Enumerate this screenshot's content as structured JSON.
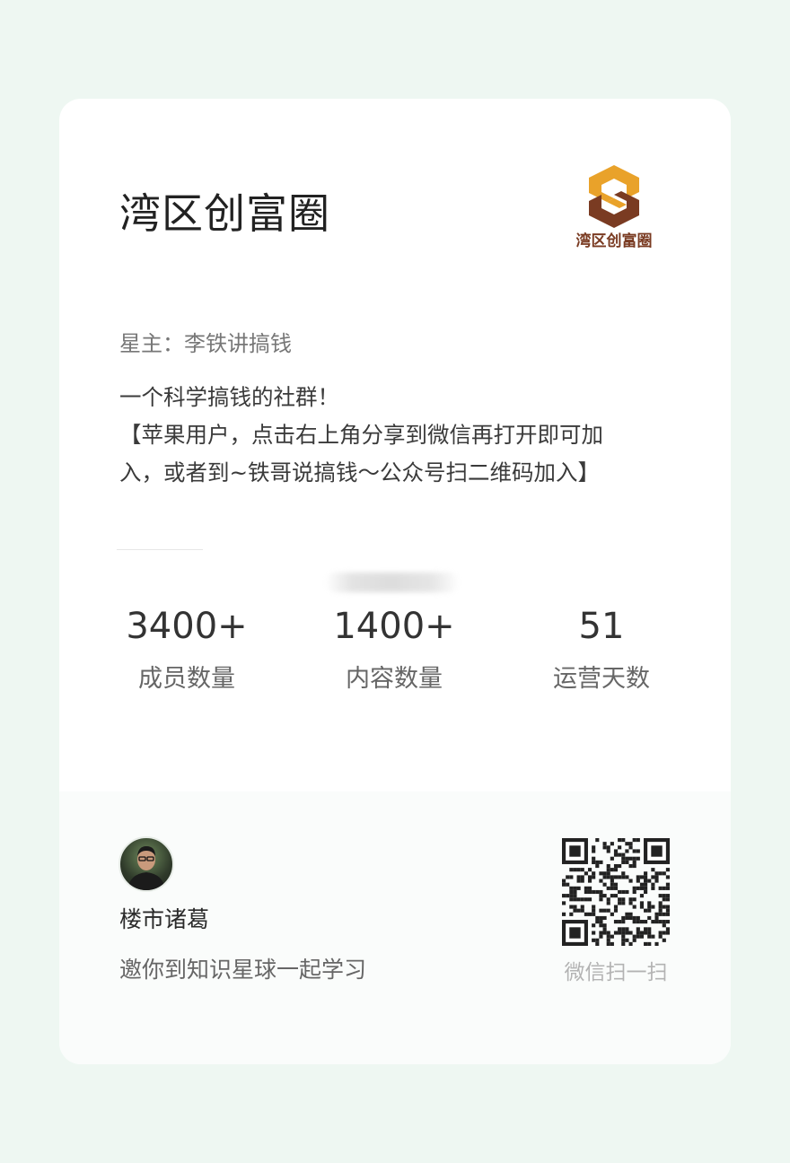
{
  "card": {
    "title": "湾区创富圈",
    "logo_text": "湾区创富圈",
    "owner": "星主：李铁讲搞钱",
    "description_lines": [
      "一个科学搞钱的社群！",
      "【苹果用户，点击右上角分享到微信再打开即可加",
      "入，或者到~铁哥说搞钱～公众号扫二维码加入】"
    ]
  },
  "stats": [
    {
      "value": "3400+",
      "label": "成员数量"
    },
    {
      "value": "1400+",
      "label": "内容数量"
    },
    {
      "value": "51",
      "label": "运营天数"
    }
  ],
  "footer": {
    "author_name": "楼市诸葛",
    "invite_text": "邀你到知识星球一起学习",
    "qr_caption": "微信扫一扫"
  },
  "icons": {
    "logo": "hexagon-s-logo-icon",
    "avatar": "user-avatar",
    "qr": "qr-code"
  },
  "colors": {
    "page_background": "#eef7f2",
    "logo_orange": "#e9a22a",
    "logo_brown": "#7a3b22",
    "title_text": "#222222"
  }
}
